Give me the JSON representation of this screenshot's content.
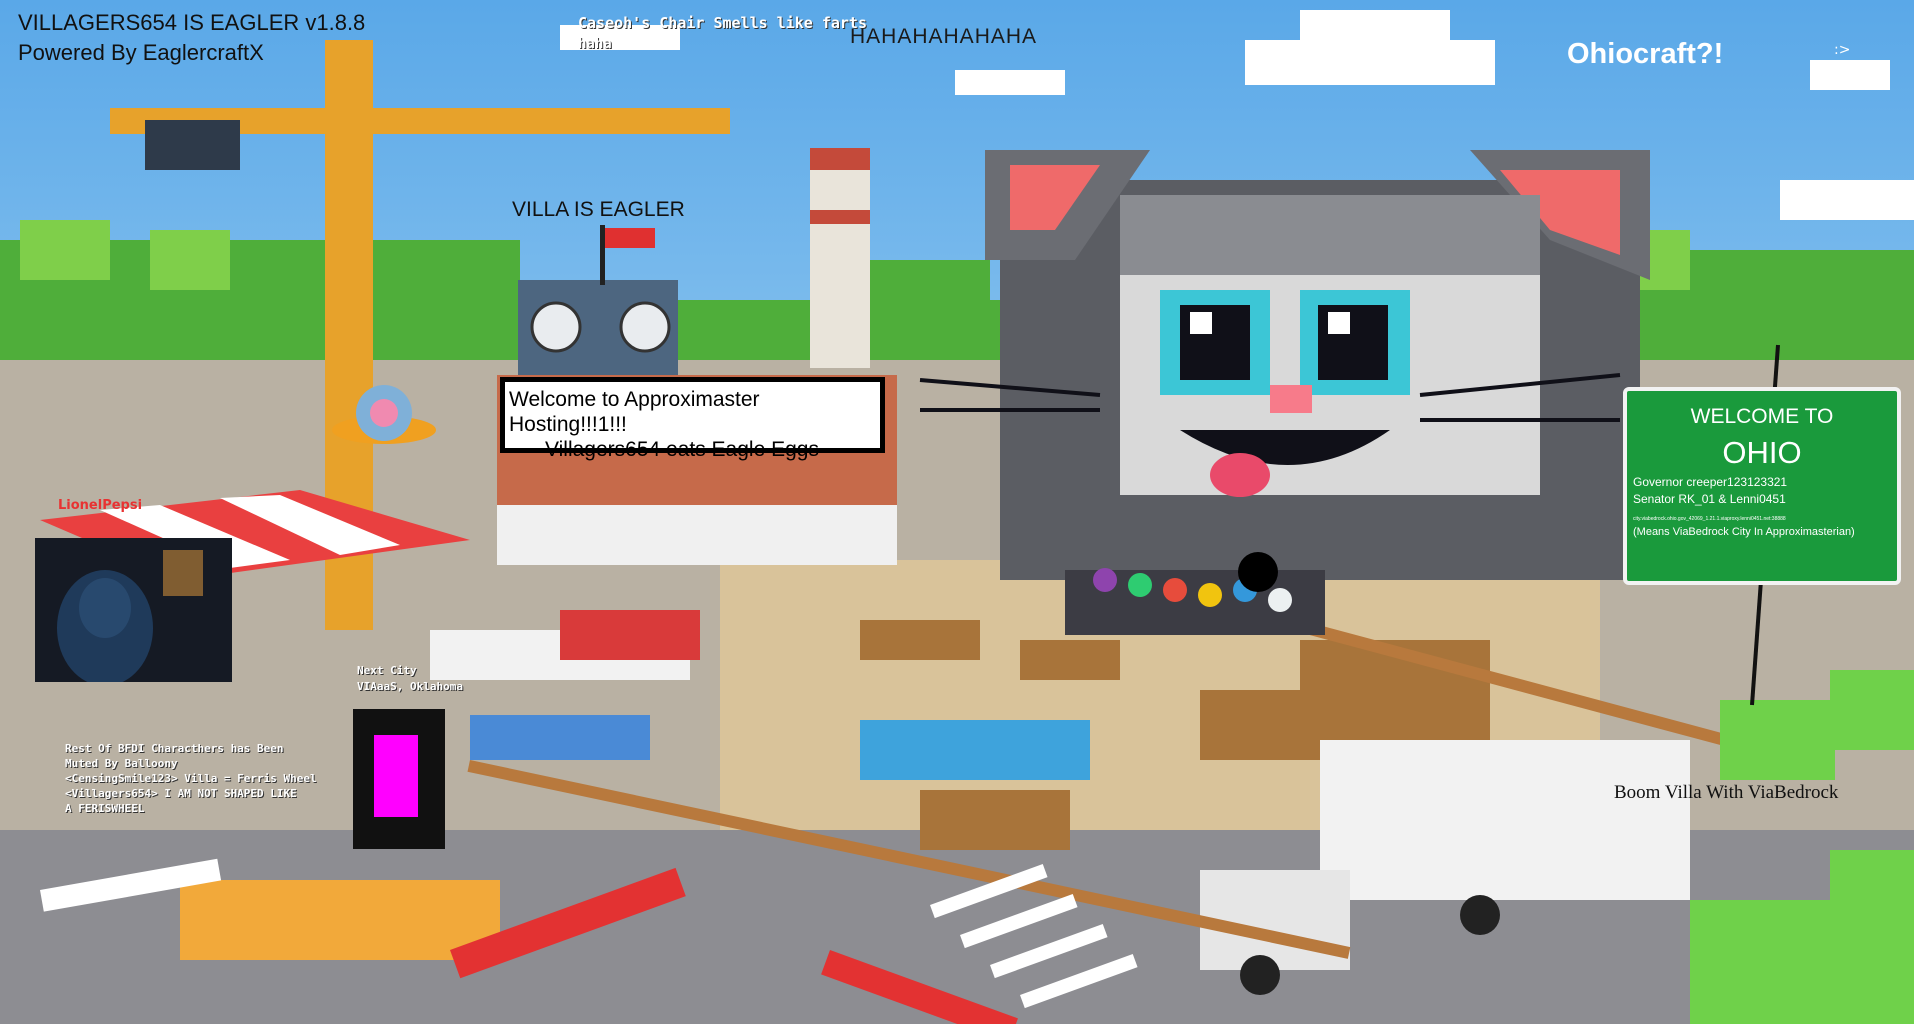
{
  "hud": {
    "title": "VILLAGERS654 IS EAGLER v1.8.8",
    "subtitle": "Powered By EaglercraftX"
  },
  "splash": {
    "top_joke_line1": "Caseoh's Chair Smells like farts",
    "top_joke_line2": "haha",
    "laugh": "HAHAHAHAHAHA",
    "ohiocraft": "Ohiocraft?!",
    "smiley": ":>",
    "villa_eagler": "VILLA IS EAGLER",
    "boom": "Boom Villa With ViaBedrock"
  },
  "welcome_box": {
    "line1": "Welcome to Approximaster Hosting!!!1!!!",
    "line2": "Villagers654 eats Eagle Eggs"
  },
  "ohio_sign": {
    "welcome": "WELCOME TO",
    "state": "OHIO",
    "governor": "Governor creeper123123321",
    "senator": "Senator RK_01 & Lenni0451",
    "address": "city.viabedrock.ohio.gov_42069_1.21.1.viaproxy.lenni0451.net:38888",
    "meaning": "(Means ViaBedrock City In Approximasterian)"
  },
  "webcam": {
    "username": "LionelPepsi"
  },
  "next_city": {
    "label": "Next City",
    "value": "VIAaaS, Oklahoma"
  },
  "chat": {
    "lines": [
      "Rest Of BFDI Characthers has Been",
      "Muted By Balloony",
      "<CensingSmile123> Villa = Ferris Wheel",
      "<Villagers654> I AM NOT SHAPED LIKE",
      "A FERISWHEEL"
    ]
  },
  "colors": {
    "sky_top": "#5aa8e8",
    "sky_bottom": "#b7def5",
    "sign_green": "#1a9a3c",
    "magenta": "#ff00ff",
    "username_red": "#e83232"
  }
}
